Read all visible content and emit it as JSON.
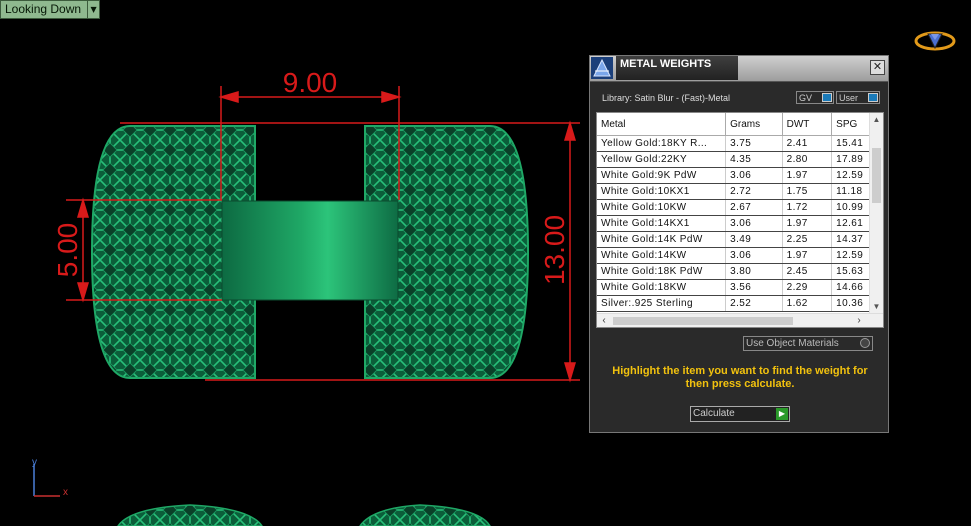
{
  "viewport": {
    "view_label": "Looking Down",
    "view_menu_icon": "chevron-down-icon",
    "axis": {
      "y": "y",
      "x": "x"
    }
  },
  "dimensions": {
    "top_width": "9.00",
    "left_height": "5.00",
    "right_height": "13.00",
    "color": "#d81a1a"
  },
  "colors": {
    "ring": "#0f7a4a",
    "ring_light": "#22b06a",
    "panel_bg": "#2a2a2a",
    "instruction_text": "#f2c20e"
  },
  "panel": {
    "title": "METAL WEIGHTS",
    "close": "✕",
    "library": "Library: Satin Blur - (Fast)-Metal",
    "toggles": [
      "GV",
      "User"
    ],
    "table": {
      "columns": [
        "Metal",
        "Grams",
        "DWT",
        "SPG"
      ],
      "rows": [
        [
          "Yellow Gold:18KY R...",
          "3.75",
          "2.41",
          "15.41"
        ],
        [
          "Yellow Gold:22KY",
          "4.35",
          "2.80",
          "17.89"
        ],
        [
          "White Gold:9K PdW",
          "3.06",
          "1.97",
          "12.59"
        ],
        [
          "White Gold:10KX1",
          "2.72",
          "1.75",
          "11.18"
        ],
        [
          "White Gold:10KW",
          "2.67",
          "1.72",
          "10.99"
        ],
        [
          "White Gold:14KX1",
          "3.06",
          "1.97",
          "12.61"
        ],
        [
          "White Gold:14K PdW",
          "3.49",
          "2.25",
          "14.37"
        ],
        [
          "White Gold:14KW",
          "3.06",
          "1.97",
          "12.59"
        ],
        [
          "White Gold:18K PdW",
          "3.80",
          "2.45",
          "15.63"
        ],
        [
          "White Gold:18KW",
          "3.56",
          "2.29",
          "14.66"
        ],
        [
          "Silver:.925 Sterling",
          "2.52",
          "1.62",
          "10.36"
        ]
      ]
    },
    "use_object_materials": "Use Object Materials",
    "instructions": "Highlight the item you want to find the weight for then press calculate.",
    "calculate": "Calculate"
  }
}
